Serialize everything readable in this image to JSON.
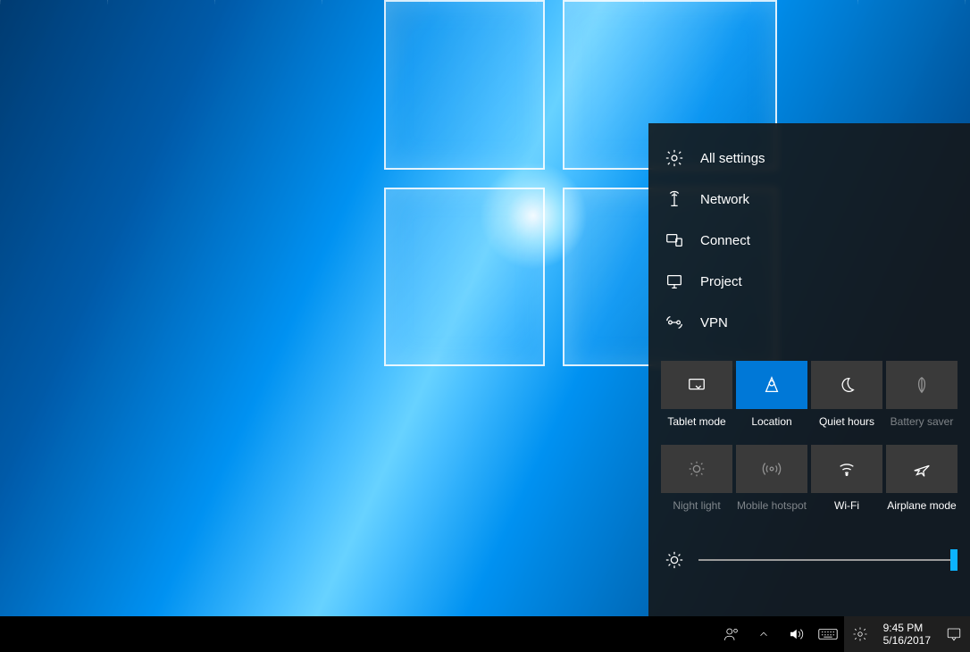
{
  "action_center": {
    "menu": [
      {
        "id": "settings",
        "label": "All settings"
      },
      {
        "id": "network",
        "label": "Network"
      },
      {
        "id": "connect",
        "label": "Connect"
      },
      {
        "id": "project",
        "label": "Project"
      },
      {
        "id": "vpn",
        "label": "VPN"
      }
    ],
    "tiles": [
      {
        "id": "tablet-mode",
        "label": "Tablet mode",
        "active": false,
        "dim": false
      },
      {
        "id": "location",
        "label": "Location",
        "active": true,
        "dim": false
      },
      {
        "id": "quiet-hours",
        "label": "Quiet hours",
        "active": false,
        "dim": false
      },
      {
        "id": "battery-saver",
        "label": "Battery saver",
        "active": false,
        "dim": true
      },
      {
        "id": "night-light",
        "label": "Night light",
        "active": false,
        "dim": true
      },
      {
        "id": "mobile-hotspot",
        "label": "Mobile hotspot",
        "active": false,
        "dim": true
      },
      {
        "id": "wifi",
        "label": "Wi-Fi",
        "active": false,
        "dim": false
      },
      {
        "id": "airplane-mode",
        "label": "Airplane mode",
        "active": false,
        "dim": false
      }
    ],
    "brightness_percent": 100
  },
  "taskbar": {
    "time": "9:45 PM",
    "date": "5/16/2017",
    "tray_icons": [
      {
        "id": "people"
      },
      {
        "id": "hidden-icons-chevron"
      },
      {
        "id": "volume"
      },
      {
        "id": "input-keyboard"
      },
      {
        "id": "settings"
      }
    ]
  }
}
